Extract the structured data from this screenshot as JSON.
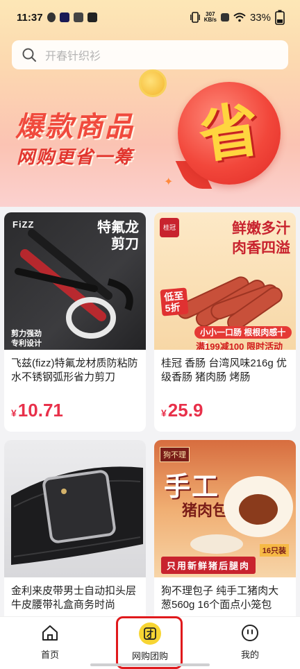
{
  "status_bar": {
    "time": "11:37",
    "network_speed": "307",
    "network_unit": "KB/s",
    "battery": "33%"
  },
  "search": {
    "placeholder": "开春针织衫"
  },
  "banner": {
    "title": "爆款商品",
    "subtitle": "网购更省一筹",
    "badge_char": "省"
  },
  "products": [
    {
      "name": "飞兹(fizz)特氟龙材质防粘防水不锈钢弧形省力剪刀",
      "currency": "¥",
      "price": "10.71",
      "image": {
        "brand": "FiZZ",
        "headline_line1": "特氟龙",
        "headline_line2": "剪刀",
        "feature_line1": "剪力强劲",
        "feature_line2": "专利设计"
      }
    },
    {
      "name": "桂冠 香肠 台湾风味216g 优级香肠 猪肉肠 烤肠",
      "currency": "¥",
      "price": "25.9",
      "image": {
        "logo": "桂冠",
        "headline_line1": "鲜嫩多汁",
        "headline_line2": "肉香四溢",
        "badge_line1": "低至",
        "badge_line2": "5折",
        "bar": "小小一口肠 根根肉感十足",
        "promo": "满199减100 限时活动"
      }
    },
    {
      "name": "金利来皮带男士自动扣头层牛皮腰带礼盒商务时尚",
      "currency": "¥",
      "price": "",
      "image": {}
    },
    {
      "name": "狗不理包子 纯手工猪肉大葱560g 16个面点小笼包",
      "currency": "¥",
      "price": "",
      "image": {
        "logo": "狗不理",
        "headline_line1": "手工",
        "headline_line2": "猪肉包",
        "bar": "只用新鲜猪后腿肉",
        "tag": "16只装"
      }
    }
  ],
  "bottom_nav": {
    "items": [
      {
        "label": "首页",
        "icon": "home-icon"
      },
      {
        "label": "网购团购",
        "icon": "group-buy-icon",
        "active": true
      },
      {
        "label": "我的",
        "icon": "profile-icon"
      }
    ]
  },
  "colors": {
    "accent": "#f7d533",
    "price": "#e8304a",
    "highlight": "#e0191c"
  }
}
